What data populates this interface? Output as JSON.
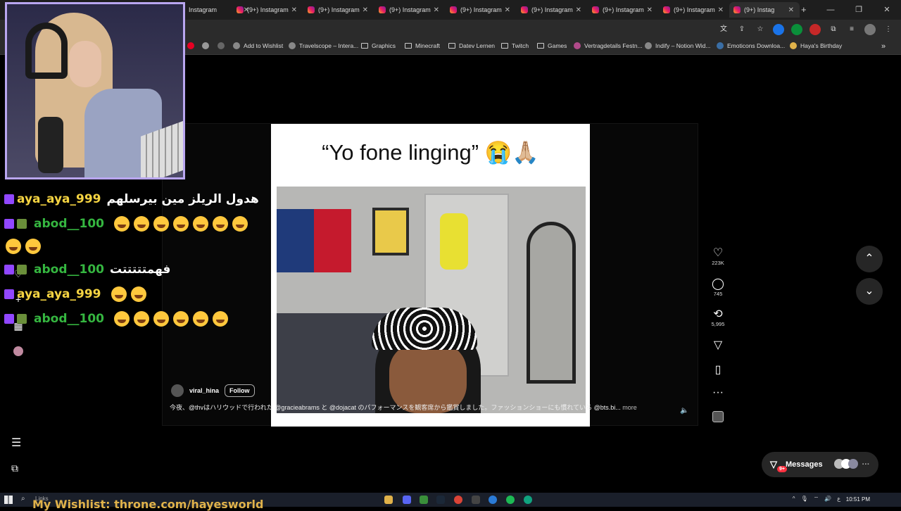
{
  "browser": {
    "tabs": [
      {
        "label": "Instagram"
      },
      {
        "label": "(9+) Instagram"
      },
      {
        "label": "(9+) Instagram"
      },
      {
        "label": "(9+) Instagram"
      },
      {
        "label": "(9+) Instagram"
      },
      {
        "label": "(9+) Instagram"
      },
      {
        "label": "(9+) Instagram"
      },
      {
        "label": "(9+) Instagram"
      },
      {
        "label": "(9+) Instag"
      }
    ],
    "bookmarks": [
      "Add to Wishlist",
      "Travelscope – Intera...",
      "Graphics",
      "Minecraft",
      "Datev Lernen",
      "Twitch",
      "Games",
      "Vertragdetails Festn...",
      "Indify – Notion Wid...",
      "Emoticons Downloa...",
      "Haya's Birthday"
    ]
  },
  "chat": {
    "messages": [
      {
        "user": "aya_aya_999",
        "text": "هدول الريلز مين بيرسلهم"
      },
      {
        "user": "abod__100",
        "text": ""
      },
      {
        "user": "abod__100",
        "text": "فهمتتتتتت"
      },
      {
        "user": "aya_aya_999",
        "text": ""
      },
      {
        "user": "abod__100",
        "text": ""
      }
    ],
    "emoji_counts": [
      0,
      9,
      0,
      2,
      6
    ]
  },
  "reel": {
    "caption": "“Yo fone linging” 😭🙏🏼",
    "username": "viral_hina",
    "follow_label": "Follow",
    "description": "今夜、@thvはハリウッドで行われた @gracieabrams と @dojacat のパフォーマンスを観客席から鑑賞しました。ファッションショーにも慣れている @bts.bi...",
    "more_label": "more",
    "likes": "223K",
    "comments": "745",
    "reposts": "5,995"
  },
  "messages_panel": {
    "label": "Messages",
    "badge": "9+"
  },
  "taskbar": {
    "search_label": "Links",
    "overlay_text": "My Wishlist: throne.com/hayesworld",
    "time": "10:51 PM"
  },
  "colors": {
    "accent_purple": "#9147ff",
    "nick_yellow": "#f5d442",
    "nick_green": "#35b640",
    "webcam_border": "#b9a6f0"
  }
}
